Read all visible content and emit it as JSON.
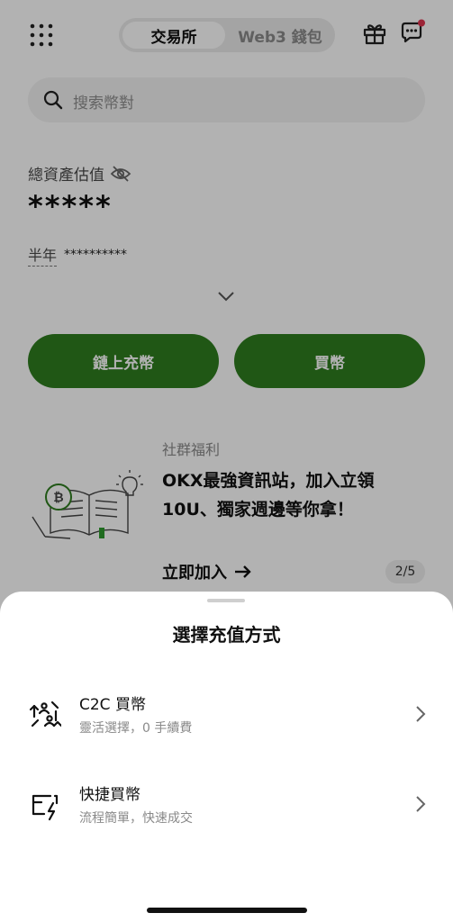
{
  "header": {
    "tabs": [
      {
        "label": "交易所",
        "active": true
      },
      {
        "label": "Web3 錢包",
        "active": false
      }
    ],
    "icons": [
      "grid-icon",
      "gift-icon",
      "message-icon"
    ]
  },
  "search": {
    "placeholder": "搜索幣對"
  },
  "assets": {
    "label": "總資產估值",
    "value": "*****",
    "period_label": "半年",
    "period_value": "**********"
  },
  "actions": {
    "deposit_label": "鏈上充幣",
    "buy_label": "買幣"
  },
  "promo": {
    "category": "社群福利",
    "title": "OKX最強資訊站，加入立領10U、獨家週邊等你拿！",
    "cta": "立即加入",
    "pager": "2/5"
  },
  "sheet": {
    "title": "選擇充值方式",
    "options": [
      {
        "title": "C2C 買幣",
        "subtitle": "靈活選擇，0 手續費",
        "icon": "c2c-exchange-icon"
      },
      {
        "title": "快捷買幣",
        "subtitle": "流程簡單，快速成交",
        "icon": "quick-buy-icon"
      }
    ]
  },
  "colors": {
    "accent_green": "#2e7d1f",
    "notification_dot": "#e0344f"
  }
}
